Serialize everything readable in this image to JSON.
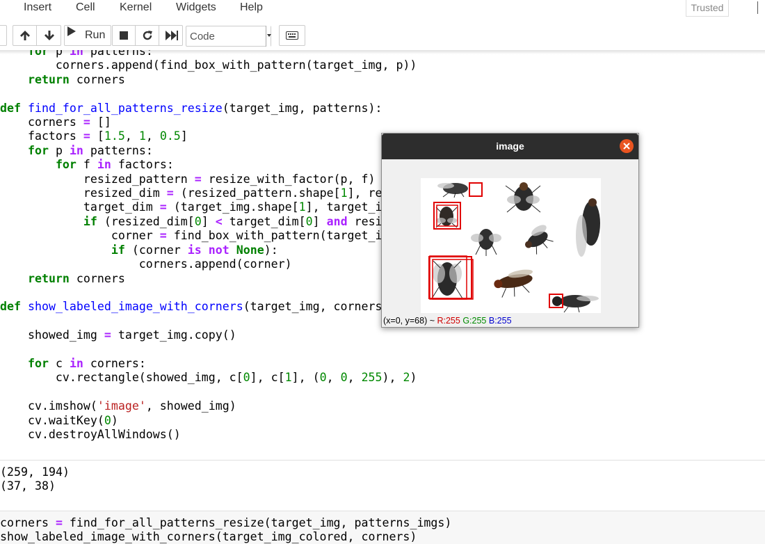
{
  "menubar": {
    "items": [
      "Insert",
      "Cell",
      "Kernel",
      "Widgets",
      "Help"
    ],
    "trusted": "Trusted"
  },
  "toolbar": {
    "run_label": "Run",
    "cell_type": "Code"
  },
  "code_cell": {
    "lines": [
      "    for p in patterns:",
      "        corners.append(find_box_with_pattern(target_img, p))",
      "    return corners",
      "",
      "def find_for_all_patterns_resize(target_img, patterns):",
      "    corners = []",
      "    factors = [1.5, 1, 0.5]",
      "    for p in patterns:",
      "        for f in factors:",
      "            resized_pattern = resize_with_factor(p, f)",
      "            resized_dim = (resized_pattern.shape[1], re",
      "            target_dim = (target_img.shape[1], target_i",
      "            if (resized_dim[0] < target_dim[0] and resi",
      "                corner = find_box_with_pattern(target_i",
      "                if (corner is not None):",
      "                    corners.append(corner)",
      "    return corners",
      "",
      "def show_labeled_image_with_corners(target_img, corners",
      "",
      "    showed_img = target_img.copy()",
      "",
      "    for c in corners:",
      "        cv.rectangle(showed_img, c[0], c[1], (0, 0, 255), 2)",
      "",
      "    cv.imshow('image', showed_img)",
      "    cv.waitKey(0)",
      "    cv.destroyAllWindows()"
    ]
  },
  "output": {
    "lines": [
      "(259, 194)",
      "(37, 38)"
    ]
  },
  "next_cell": {
    "lines": [
      "corners = find_for_all_patterns_resize(target_img, patterns_imgs)",
      "show_labeled_image_with_corners(target_img_colored, corners)"
    ]
  },
  "image_window": {
    "title": "image",
    "status_coords": "(x=0, y=68) ~ ",
    "status_r": "R:255",
    "status_g": "G:255",
    "status_b": "B:255",
    "box_color": "#e00000"
  }
}
